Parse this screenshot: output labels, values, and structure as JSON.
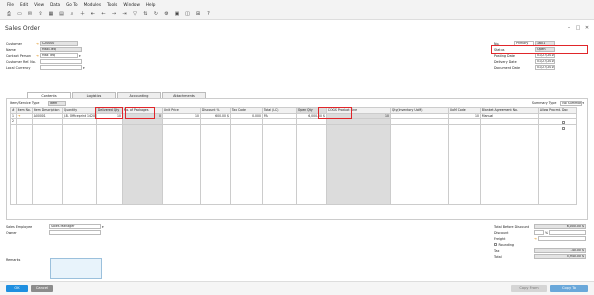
{
  "menu": [
    "File",
    "Edit",
    "View",
    "Data",
    "Go To",
    "Modules",
    "Tools",
    "Window",
    "Help"
  ],
  "toolbar_icons": [
    "print-icon",
    "preview-icon",
    "email-icon",
    "export-icon",
    "excel-icon",
    "word-icon",
    "find-icon",
    "add-icon",
    "first-record-icon",
    "previous-record-icon",
    "next-record-icon",
    "last-record-icon",
    "filter-icon",
    "sort-icon",
    "refresh-icon",
    "settings-icon",
    "layout-icon",
    "gross-profit-icon",
    "relationship-map-icon",
    "help-icon"
  ],
  "window": {
    "title": "Sales Order"
  },
  "header": {
    "customer_label": "Customer",
    "customer_value": "C20000",
    "name_label": "Name",
    "name_value": "Maxi-Teq",
    "contact_label": "Contact Person",
    "contact_value": "Max Teq",
    "custref_label": "Customer Ref. No.",
    "custref_value": "",
    "currency_label": "Local Currency",
    "currency_value": ""
  },
  "right_header": {
    "no_label": "No.",
    "no_series": "Primary",
    "no_value": "1601",
    "status_label": "Status",
    "status_value": "Open",
    "posting_label": "Posting Date",
    "posting_value": "01/27/2016",
    "delivery_label": "Delivery Date",
    "delivery_value": "01/27/2016",
    "document_label": "Document Date",
    "document_value": "01/27/2016"
  },
  "tabs": [
    "Contents",
    "Logistics",
    "Accounting",
    "Attachments"
  ],
  "grid": {
    "item_service_type_label": "Item/Service Type",
    "item_service_type_value": "Item",
    "summary_type_label": "Summary Type",
    "summary_type_value": "No Summary",
    "columns": [
      "#",
      "Item No.",
      "Item Description",
      "Quantity",
      "Delivered Qty",
      "No. of Packages",
      "Unit Price",
      "Discount %",
      "Tax Code",
      "Total (LC)",
      "Open Qty",
      "COGS Product Line",
      "Qty(Inventory UoM)",
      "UoM Code",
      "Blanket Agreement No.",
      "Allow Procmt. Doc"
    ],
    "rows": [
      [
        "1",
        "A00001",
        "J.B. Officeprint 1420",
        "10",
        "0",
        "10",
        "600.00 $",
        "0.000",
        "PA",
        "6,000.00 $",
        "10",
        "",
        "10",
        "Manual",
        "",
        ""
      ],
      [
        "2",
        "",
        "",
        "",
        "",
        "",
        "",
        "",
        "",
        "",
        "",
        "",
        "",
        "",
        "",
        ""
      ]
    ]
  },
  "bottom": {
    "sales_employee_label": "Sales Employee",
    "sales_employee_value": "Sales Manager",
    "owner_label": "Owner",
    "owner_value": "",
    "remarks_label": "Remarks"
  },
  "totals": {
    "before_discount_label": "Total Before Discount",
    "before_discount_value": "6,000.00 $",
    "discount_label": "Discount",
    "discount_pct": "%",
    "discount_value": "",
    "freight_label": "Freight",
    "freight_value": "",
    "rounding_label": "Rounding",
    "tax_label": "Tax",
    "tax_value": "-40.00 $",
    "total_label": "Total",
    "total_value": "5,940.00 $"
  },
  "footer": {
    "ok_label": "OK",
    "cancel_label": "Cancel",
    "copy_from_label": "Copy From",
    "copy_to_label": "Copy To"
  },
  "colors": {
    "accent": "#1f8fe0",
    "highlight": "#e0262a",
    "field_grey": "#e3e3e3"
  }
}
